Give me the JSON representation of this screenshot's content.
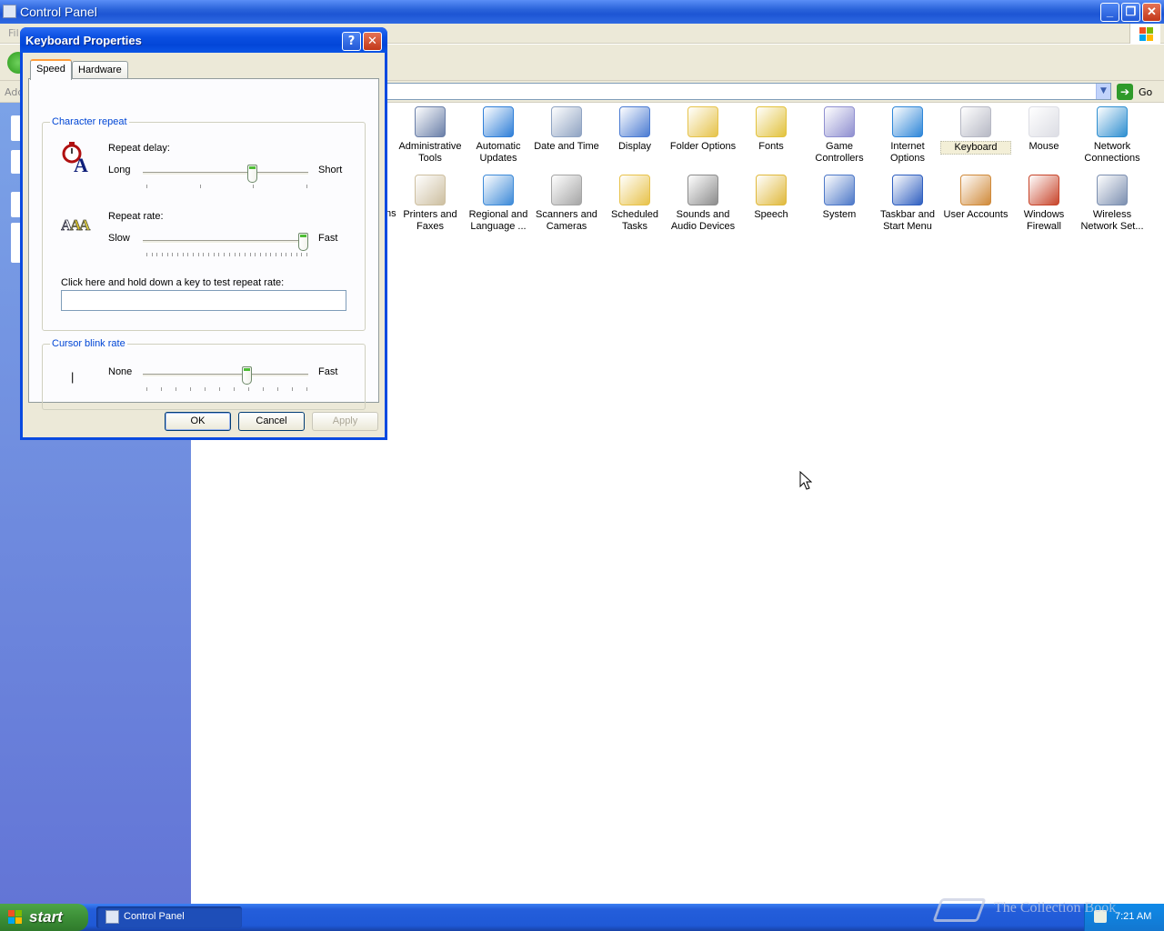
{
  "main_window": {
    "title": "Control Panel",
    "menu_partial": "Fil",
    "address_label_partial": "Add",
    "go_label": "Go",
    "icons": [
      {
        "label": "Administrative\nTools",
        "icon": "admin-tools-icon",
        "color": "#6a7fa8"
      },
      {
        "label": "Automatic\nUpdates",
        "icon": "automatic-updates-icon",
        "color": "#2f7fd8"
      },
      {
        "label": "Date and Time",
        "icon": "date-time-icon",
        "color": "#8fa3c2"
      },
      {
        "label": "Display",
        "icon": "display-icon",
        "color": "#4b7bd2"
      },
      {
        "label": "Folder Options",
        "icon": "folder-options-icon",
        "color": "#e6c34b"
      },
      {
        "label": "Fonts",
        "icon": "fonts-icon",
        "color": "#e2c23d"
      },
      {
        "label": "Game\nControllers",
        "icon": "game-controllers-icon",
        "color": "#8f8fd0"
      },
      {
        "label": "Internet\nOptions",
        "icon": "internet-options-icon",
        "color": "#2e86d8"
      },
      {
        "label": "Keyboard",
        "icon": "keyboard-icon",
        "color": "#b6b8c4",
        "selected": true
      },
      {
        "label": "Mouse",
        "icon": "mouse-icon",
        "color": "#dcdde4"
      },
      {
        "label": "Network\nConnections",
        "icon": "network-connections-icon",
        "color": "#2f8fd0"
      },
      {
        "label": "Printers and\nFaxes",
        "icon": "printers-faxes-icon",
        "color": "#cdbfa0"
      },
      {
        "label": "Regional and\nLanguage ...",
        "icon": "regional-language-icon",
        "color": "#3d8ad8"
      },
      {
        "label": "Scanners and\nCameras",
        "icon": "scanners-cameras-icon",
        "color": "#a5a5a5"
      },
      {
        "label": "Scheduled\nTasks",
        "icon": "scheduled-tasks-icon",
        "color": "#e8c24a"
      },
      {
        "label": "Sounds and\nAudio Devices",
        "icon": "sounds-audio-icon",
        "color": "#8c8c8c"
      },
      {
        "label": "Speech",
        "icon": "speech-icon",
        "color": "#e0b93c"
      },
      {
        "label": "System",
        "icon": "system-icon",
        "color": "#4d78c8"
      },
      {
        "label": "Taskbar and\nStart Menu",
        "icon": "taskbar-start-menu-icon",
        "color": "#2f5fc0"
      },
      {
        "label": "User Accounts",
        "icon": "user-accounts-icon",
        "color": "#d08a3a"
      },
      {
        "label": "Windows\nFirewall",
        "icon": "windows-firewall-icon",
        "color": "#c8452b"
      },
      {
        "label": "Wireless\nNetwork Set...",
        "icon": "wireless-network-icon",
        "color": "#7c8fb0"
      }
    ],
    "partial_label": "ns"
  },
  "dialog": {
    "title": "Keyboard Properties",
    "help_glyph": "?",
    "close_glyph": "✕",
    "tabs": [
      "Speed",
      "Hardware"
    ],
    "character_repeat": {
      "group_label": "Character repeat",
      "delay_label": "Repeat delay:",
      "delay_left": "Long",
      "delay_right": "Short",
      "delay_value": 0.67,
      "rate_label": "Repeat rate:",
      "rate_left": "Slow",
      "rate_right": "Fast",
      "rate_value": 1.0,
      "test_label": "Click here and hold down a key to test repeat rate:",
      "test_value": ""
    },
    "cursor_blink": {
      "group_label": "Cursor blink rate",
      "left": "None",
      "right": "Fast",
      "value": 0.64,
      "cursor_glyph": "|"
    },
    "buttons": {
      "ok": "OK",
      "cancel": "Cancel",
      "apply": "Apply"
    }
  },
  "taskbar": {
    "start_label": "start",
    "task_label": "Control Panel",
    "clock": "7:21 AM",
    "watermark": "The Collection Book"
  },
  "colors": {
    "xp_blue": "#0a4ae0",
    "start_green": "#3c8f37",
    "group_label": "#0046d5"
  }
}
